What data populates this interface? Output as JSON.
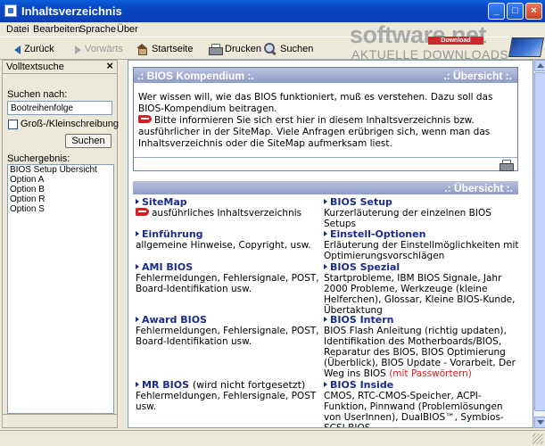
{
  "window": {
    "title": "Inhaltsverzeichnis"
  },
  "menu": [
    "Datei",
    "Bearbeiten",
    "Sprache",
    "Über"
  ],
  "toolbar": {
    "back": "Zurück",
    "forward": "Vorwärts",
    "home": "Startseite",
    "print": "Drucken",
    "search": "Suchen"
  },
  "logo": {
    "brand": "software.net",
    "badge": "Download",
    "sub": "AKTUELLE DOWNLOADS"
  },
  "sidebar": {
    "title": "Volltextsuche",
    "search_label": "Suchen nach:",
    "search_value": "Bootreihenfolge",
    "checkbox_label": "Groß-/Kleinschreibung",
    "search_button": "Suchen",
    "results_label": "Suchergebnis:",
    "results": [
      "BIOS Setup Übersicht",
      "Option A",
      "Option B",
      "Option R",
      "Option S"
    ]
  },
  "main": {
    "kompendium": {
      "title": ".: BIOS Kompendium :.",
      "right": ".: Übersicht :.",
      "p1": "Wer wissen will, wie das BIOS funktioniert, muß es verstehen. Dazu soll das BIOS-Kompendium beitragen.",
      "p2": "Bitte informieren Sie sich erst hier in diesem Inhaltsverzeichnis bzw. ausführlicher in der SiteMap. Viele Anfragen erübrigen sich, wenn man das Inhaltsverzeichnis oder die SiteMap aufmerksam liest."
    },
    "uebersicht": ".: Übersicht :.",
    "left": [
      {
        "title": "SiteMap",
        "desc": "ausführliches Inhaltsverzeichnis"
      },
      {
        "title": "Einführung",
        "desc": "allgemeine Hinweise, Copyright, usw."
      },
      {
        "title": "AMI BIOS",
        "desc": "Fehlermeldungen, Fehlersignale, POST, Board-Identifikation usw."
      },
      {
        "title": "Award BIOS",
        "desc": "Fehlermeldungen, Fehlersignale, POST, Board-Identifikation usw."
      },
      {
        "title": "MR BIOS",
        "extra": "(wird nicht fortgesetzt)",
        "desc": "Fehlermeldungen, Fehlersignale, POST usw."
      }
    ],
    "right": [
      {
        "title": "BIOS Setup",
        "desc": "Kurzerläuterung der einzelnen BIOS Setups"
      },
      {
        "title": "Einstell-Optionen",
        "desc": "Erläuterung der Einstellmöglichkeiten mit Optimierungsvorschlägen"
      },
      {
        "title": "BIOS Spezial",
        "desc": "Startprobleme, IBM BIOS Signale, Jahr 2000 Probleme, Werkzeuge (kleine Helferchen), Glossar, Kleine BIOS-Kunde, Übertaktung"
      },
      {
        "title": "BIOS Intern",
        "desc": "BIOS Flash Anleitung (richtig updaten), Identifikation des Motherboards/BIOS, Reparatur des BIOS, BIOS Optimierung (Überblick), BIOS Update - Vorarbeit, Der Weg ins BIOS",
        "desc_red": "(mit Passwörtern)"
      },
      {
        "title": "BIOS Inside",
        "desc": "CMOS, RTC-CMOS-Speicher, ACPI-Funktion, Pinnwand (Problemlösungen von UserInnen), DualBIOS™, Symbios-SCSI-BIOS"
      }
    ]
  },
  "colors": {
    "titlebar": "#0a4fc8",
    "bar": "#8e9cc6",
    "link": "#1a2b8c",
    "accent": "#d81e1e"
  }
}
